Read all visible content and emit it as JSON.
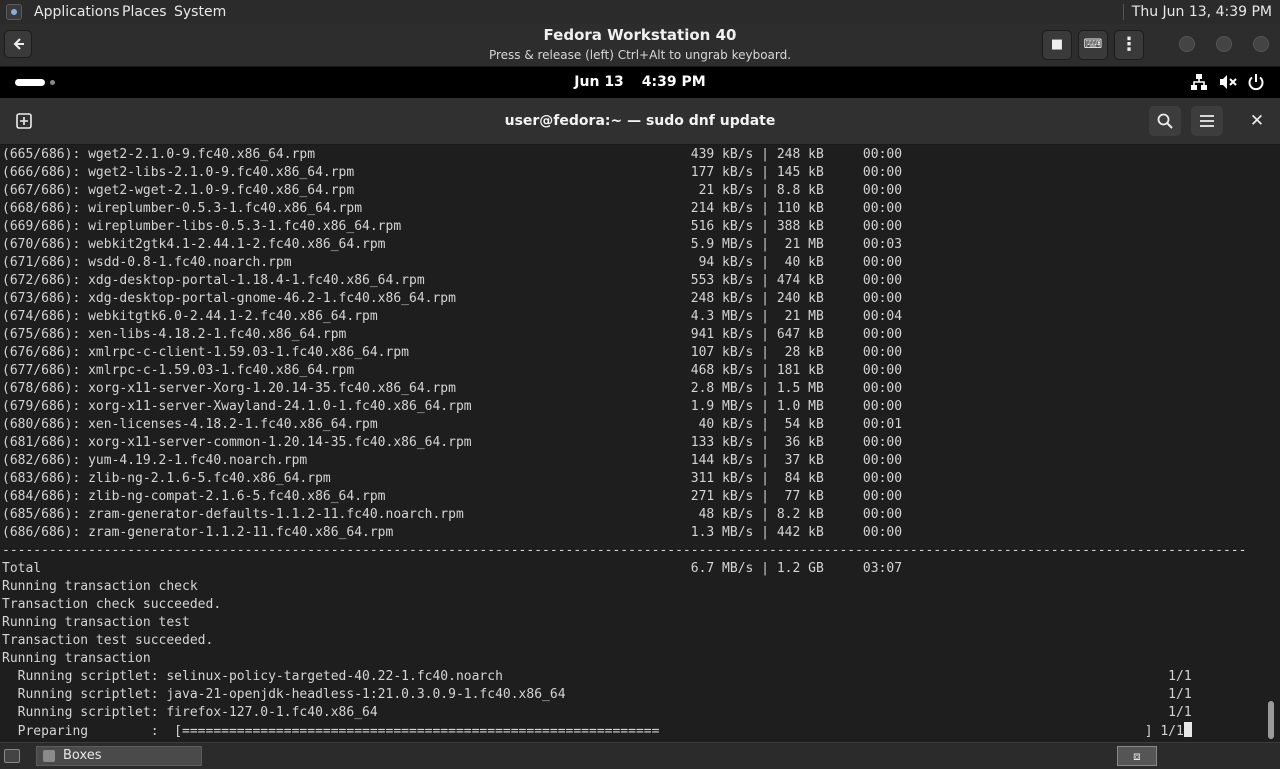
{
  "host_panel": {
    "menus": [
      "Applications",
      "Places",
      "System"
    ],
    "clock": "Thu Jun 13,  4:39 PM"
  },
  "boxes": {
    "back_icon": "back-arrow-icon",
    "title": "Fedora Workstation 40",
    "subtitle": "Press & release (left) Ctrl+Alt to ungrab keyboard.",
    "buttons": {
      "stop_icon": "■",
      "keyboard_icon": "⌨",
      "menu_icon": "⋮"
    }
  },
  "guest_bar": {
    "date": "Jun 13",
    "time": "4:39 PM",
    "icons": {
      "network": "network-wired-icon",
      "volume": "volume-muted-icon",
      "power": "power-icon"
    }
  },
  "terminal": {
    "title": "user@fedora:~ — sudo dnf update",
    "new_tab_icon": "⊞",
    "search_icon": "⌕",
    "menu_icon": "☰",
    "close_icon": "✕",
    "lines": [
      "(665/686): wget2-2.1.0-9.fc40.x86_64.rpm                                                439 kB/s | 248 kB     00:00",
      "(666/686): wget2-libs-2.1.0-9.fc40.x86_64.rpm                                           177 kB/s | 145 kB     00:00",
      "(667/686): wget2-wget-2.1.0-9.fc40.x86_64.rpm                                            21 kB/s | 8.8 kB     00:00",
      "(668/686): wireplumber-0.5.3-1.fc40.x86_64.rpm                                          214 kB/s | 110 kB     00:00",
      "(669/686): wireplumber-libs-0.5.3-1.fc40.x86_64.rpm                                     516 kB/s | 388 kB     00:00",
      "(670/686): webkit2gtk4.1-2.44.1-2.fc40.x86_64.rpm                                       5.9 MB/s |  21 MB     00:03",
      "(671/686): wsdd-0.8-1.fc40.noarch.rpm                                                    94 kB/s |  40 kB     00:00",
      "(672/686): xdg-desktop-portal-1.18.4-1.fc40.x86_64.rpm                                  553 kB/s | 474 kB     00:00",
      "(673/686): xdg-desktop-portal-gnome-46.2-1.fc40.x86_64.rpm                              248 kB/s | 240 kB     00:00",
      "(674/686): webkitgtk6.0-2.44.1-2.fc40.x86_64.rpm                                        4.3 MB/s |  21 MB     00:04",
      "(675/686): xen-libs-4.18.2-1.fc40.x86_64.rpm                                            941 kB/s | 647 kB     00:00",
      "(676/686): xmlrpc-c-client-1.59.03-1.fc40.x86_64.rpm                                    107 kB/s |  28 kB     00:00",
      "(677/686): xmlrpc-c-1.59.03-1.fc40.x86_64.rpm                                           468 kB/s | 181 kB     00:00",
      "(678/686): xorg-x11-server-Xorg-1.20.14-35.fc40.x86_64.rpm                              2.8 MB/s | 1.5 MB     00:00",
      "(679/686): xorg-x11-server-Xwayland-24.1.0-1.fc40.x86_64.rpm                            1.9 MB/s | 1.0 MB     00:00",
      "(680/686): xen-licenses-4.18.2-1.fc40.x86_64.rpm                                         40 kB/s |  54 kB     00:01",
      "(681/686): xorg-x11-server-common-1.20.14-35.fc40.x86_64.rpm                            133 kB/s |  36 kB     00:00",
      "(682/686): yum-4.19.2-1.fc40.noarch.rpm                                                 144 kB/s |  37 kB     00:00",
      "(683/686): zlib-ng-2.1.6-5.fc40.x86_64.rpm                                              311 kB/s |  84 kB     00:00",
      "(684/686): zlib-ng-compat-2.1.6-5.fc40.x86_64.rpm                                       271 kB/s |  77 kB     00:00",
      "(685/686): zram-generator-defaults-1.1.2-11.fc40.noarch.rpm                              48 kB/s | 8.2 kB     00:00",
      "(686/686): zram-generator-1.1.2-11.fc40.x86_64.rpm                                      1.3 MB/s | 442 kB     00:00",
      "---------------------------------------------------------------------------------------------------------------------------------------------------------------",
      "Total                                                                                   6.7 MB/s | 1.2 GB     03:07",
      "Running transaction check",
      "Transaction check succeeded.",
      "Running transaction test",
      "Transaction test succeeded.",
      "Running transaction",
      "  Running scriptlet: selinux-policy-targeted-40.22-1.fc40.noarch                                                                                     1/1",
      "  Running scriptlet: java-21-openjdk-headless-1:21.0.3.0.9-1.fc40.x86_64                                                                             1/1",
      "  Running scriptlet: firefox-127.0-1.fc40.x86_64                                                                                                     1/1",
      "  Preparing        :  [=============================================================                                                              ] 1/1"
    ]
  },
  "taskbar": {
    "task_label": "Boxes",
    "workspace_icon": "⧈"
  }
}
